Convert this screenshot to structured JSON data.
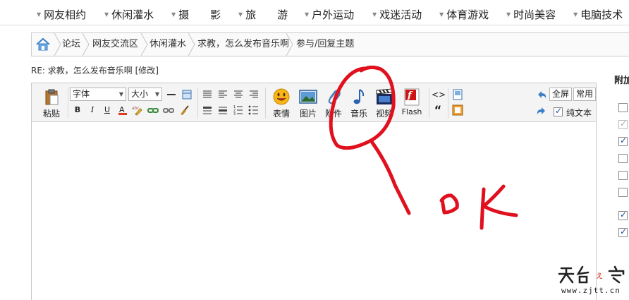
{
  "topnav": {
    "items": [
      {
        "label": "网友相约"
      },
      {
        "label": "休闲灌水"
      },
      {
        "label": "摄　　影"
      },
      {
        "label": "旅　　游"
      },
      {
        "label": "户外运动"
      },
      {
        "label": "戏迷活动"
      },
      {
        "label": "体育游戏"
      },
      {
        "label": "时尚美容"
      },
      {
        "label": "电脑技术"
      }
    ]
  },
  "breadcrumb": {
    "items": [
      "论坛",
      "网友交流区",
      "休闲灌水",
      "求教，怎么发布音乐啊",
      "参与/回复主题"
    ]
  },
  "post": {
    "title": "RE: 求教，怎么发布音乐啊",
    "edit": "[修改]"
  },
  "toolbar": {
    "paste": "粘贴",
    "font_select": "字体",
    "size_select": "大小",
    "emoticon": "表情",
    "image": "图片",
    "attachment": "附件",
    "music": "音乐",
    "video": "视频",
    "flash": "Flash",
    "fullscreen": "全屏",
    "common": "常用",
    "plain_text": "纯文本",
    "flash_glyph": "f",
    "quote_glyph": "“",
    "code_glyph": "<>"
  },
  "sidebar": {
    "title": "附加"
  },
  "annotation": {
    "text": "ok",
    "color": "#e0101e"
  },
  "watermark": {
    "site": "www.zjtt.cn"
  },
  "colors": {
    "link": "#333333",
    "toolbar_bg": "#f4f4f4",
    "check": "#1a4d9c"
  }
}
